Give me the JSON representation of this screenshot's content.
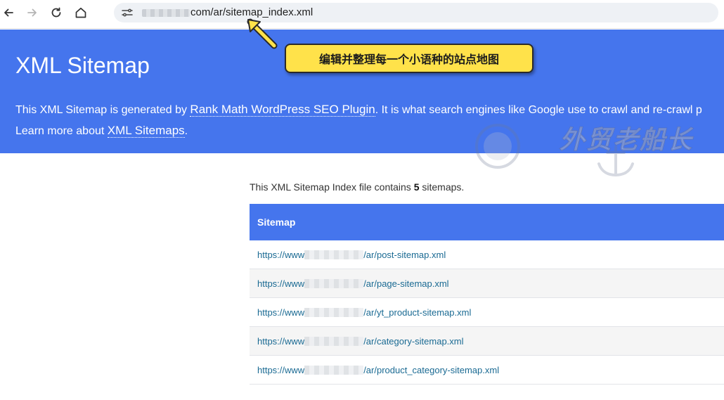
{
  "browser": {
    "nav_icons": [
      "back-arrow-icon",
      "forward-arrow-icon",
      "reload-icon",
      "home-icon"
    ],
    "url_suffix": "com/ar/sitemap_index.xml"
  },
  "annotation": {
    "callout_text": "编辑并整理每一个小语种的站点地图",
    "watermark_text": "外贸老船长"
  },
  "hero": {
    "title": "XML Sitemap",
    "line1_prefix": "This XML Sitemap is generated by ",
    "line1_link": "Rank Math WordPress SEO Plugin",
    "line1_suffix": ". It is what search engines like Google use to crawl and re-crawl p",
    "line2_prefix": "Learn more about ",
    "line2_link": "XML Sitemaps",
    "line2_suffix": "."
  },
  "summary": {
    "prefix": "This XML Sitemap Index file contains ",
    "count": "5",
    "suffix": " sitemaps."
  },
  "table": {
    "header": "Sitemap",
    "rows": [
      {
        "prefix": "https://www",
        "suffix": "/ar/post-sitemap.xml"
      },
      {
        "prefix": "https://www",
        "suffix": "/ar/page-sitemap.xml"
      },
      {
        "prefix": "https://www",
        "suffix": "/ar/yt_product-sitemap.xml"
      },
      {
        "prefix": "https://www",
        "suffix": "/ar/category-sitemap.xml"
      },
      {
        "prefix": "https://www",
        "suffix": "/ar/product_category-sitemap.xml"
      }
    ]
  },
  "colors": {
    "accent_blue": "#4575ed",
    "link": "#1a6a93",
    "callout_yellow": "#ffe24a"
  }
}
